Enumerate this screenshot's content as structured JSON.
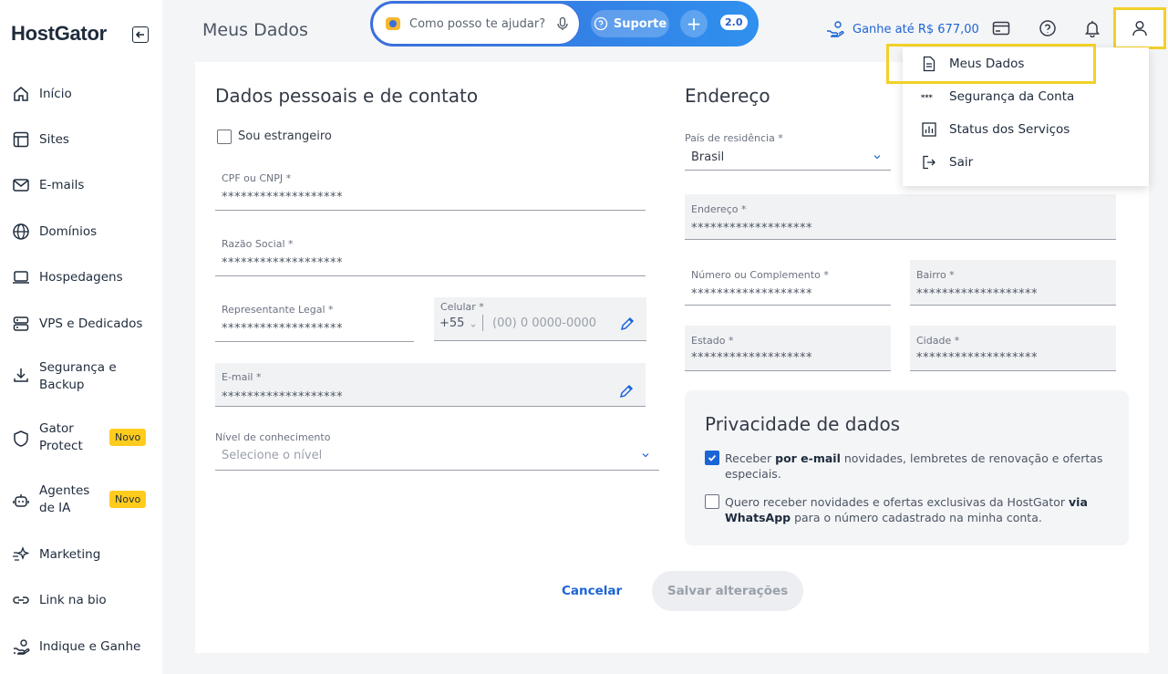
{
  "brand": {
    "logo_text": "HostGator"
  },
  "sidebar": {
    "items": [
      {
        "label": "Início",
        "icon": "home-icon"
      },
      {
        "label": "Sites",
        "icon": "layout-icon"
      },
      {
        "label": "E-mails",
        "icon": "mail-icon"
      },
      {
        "label": "Domínios",
        "icon": "globe-icon"
      },
      {
        "label": "Hospedagens",
        "icon": "laptop-icon"
      },
      {
        "label": "VPS e Dedicados",
        "icon": "server-icon"
      },
      {
        "label": "Segurança e Backup",
        "icon": "download-icon"
      },
      {
        "label": "Gator Protect",
        "icon": "shield-icon",
        "badge": "Novo"
      },
      {
        "label": "Agentes de IA",
        "icon": "robot-icon",
        "badge": "Novo"
      },
      {
        "label": "Marketing",
        "icon": "sparkle-icon"
      },
      {
        "label": "Link na bio",
        "icon": "link-icon"
      },
      {
        "label": "Indique e Ganhe",
        "icon": "hand-coin-icon"
      }
    ]
  },
  "header": {
    "page_title": "Meus Dados",
    "assistant_placeholder": "Como posso te ajudar?",
    "support_label": "Suporte",
    "plus_label": "+",
    "version_label": "2.0",
    "earn_label": "Ganhe até R$ 677,00"
  },
  "personal": {
    "title": "Dados pessoais e de contato",
    "foreigner_label": "Sou estrangeiro",
    "cpf": {
      "label": "CPF ou CNPJ *",
      "value": "*******************"
    },
    "razao": {
      "label": "Razão Social *",
      "value": "*******************"
    },
    "representante": {
      "label": "Representante Legal *",
      "value": "*******************"
    },
    "celular": {
      "label": "Celular *",
      "ddi": "+55",
      "placeholder": "(00) 0 0000-0000"
    },
    "email": {
      "label": "E-mail *",
      "value": "*******************"
    },
    "nivel": {
      "label": "Nível de conhecimento",
      "placeholder": "Selecione o nível"
    }
  },
  "address": {
    "title": "Endereço",
    "pais": {
      "label": "País de residência *",
      "value": "Brasil"
    },
    "endereco": {
      "label": "Endereço *",
      "value": "*******************"
    },
    "numero": {
      "label": "Número ou Complemento *",
      "value": "*******************"
    },
    "bairro": {
      "label": "Bairro *",
      "value": "*******************"
    },
    "estado": {
      "label": "Estado *",
      "value": "*******************"
    },
    "cidade": {
      "label": "Cidade *",
      "value": "*******************"
    }
  },
  "privacy": {
    "title": "Privacidade de dados",
    "opt1": {
      "checked": true,
      "prefix": "Receber ",
      "bold": "por e-mail",
      "suffix": " novidades, lembretes de renovação e ofertas especiais."
    },
    "opt2": {
      "checked": false,
      "prefix": "Quero receber novidades e ofertas exclusivas da HostGator ",
      "bold": "via WhatsApp",
      "suffix": " para o número cadastrado na minha conta."
    }
  },
  "actions": {
    "cancel_label": "Cancelar",
    "save_label": "Salvar alterações"
  },
  "user_menu": {
    "items": [
      {
        "label": "Meus Dados",
        "icon": "document-icon"
      },
      {
        "label": "Segurança da Conta",
        "icon": "password-dots-icon"
      },
      {
        "label": "Status dos Serviços",
        "icon": "bar-chart-icon"
      },
      {
        "label": "Sair",
        "icon": "logout-icon"
      }
    ]
  },
  "colors": {
    "accent": "#1b64d6",
    "highlight": "#f2d028",
    "badge": "#ffcc1d"
  }
}
